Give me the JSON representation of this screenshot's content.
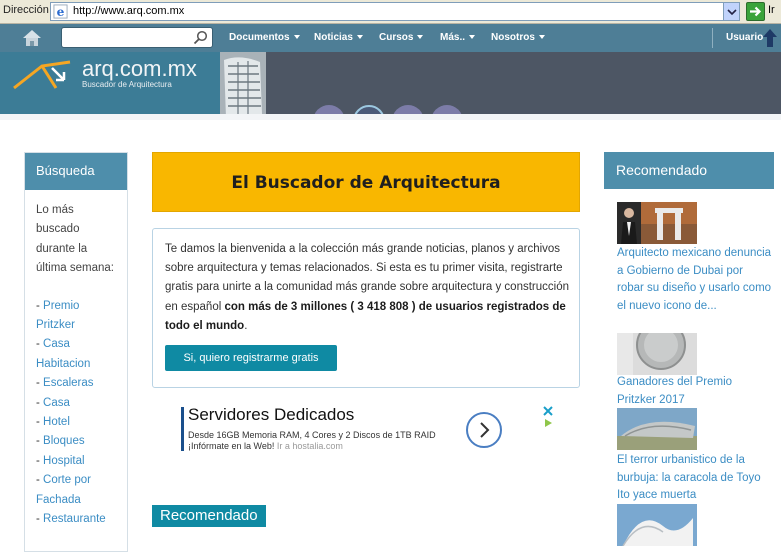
{
  "address_bar": {
    "label": "Dirección",
    "url": "http://www.arq.com.mx",
    "go_label": "Ir"
  },
  "nav": {
    "search_placeholder": "",
    "items": [
      {
        "label": "Documentos"
      },
      {
        "label": "Noticias"
      },
      {
        "label": "Cursos"
      },
      {
        "label": "Más.."
      },
      {
        "label": "Nosotros"
      }
    ],
    "user_label": "Usuario"
  },
  "banner": {
    "logo_title": "arq.com.mx",
    "logo_subtitle": "Buscador de Arquitectura"
  },
  "left_sidebar": {
    "title": "Búsqueda",
    "intro": "Lo más buscado durante la última semana:",
    "links": [
      "Premio Pritzker",
      "Casa Habitacion",
      "Escaleras",
      "Casa",
      "Hotel",
      "Bloques",
      "Hospital",
      "Corte por Fachada",
      "Restaurante"
    ]
  },
  "hero": {
    "title": "El Buscador de Arquitectura"
  },
  "welcome": {
    "text": "Te damos la bienvenida a la colección más grande noticias, planos y archivos sobre arquitectura y temas relacionados. Si esta es tu primer visita, registrarte gratis para unirte a la comunidad más grande sobre arquitectura y construcción en español ",
    "bold": "con más de 3 millones ( 3 418 808 ) de usuarios registrados de todo el mundo",
    "end": ".",
    "button": "Si, quiero registrarme gratis"
  },
  "ad": {
    "title": "Servidores Dedicados",
    "line1": "Desde 16GB Memoria RAM, 4 Cores y 2 Discos de 1TB RAID",
    "line2": "¡Infórmate en la Web!",
    "line2_link": "Ir a hostalia.com"
  },
  "center_recommended": "Recomendado",
  "right_sidebar": {
    "title": "Recomendado",
    "articles": [
      {
        "title": "Arquitecto mexicano denuncia a Gobierno de Dubai por robar su diseño y usarlo como el nuevo icono de..."
      },
      {
        "title": "Ganadores del Premio Pritzker 2017"
      },
      {
        "title": "El terror urbanistico de la burbuja: la caracola de Toyo Ito yace muerta"
      }
    ]
  },
  "colors": {
    "nav_bg": "#4e7e96",
    "panel_head": "#4e8eab",
    "hero_bg": "#f9b700",
    "link": "#3b8dc4",
    "button": "#0f8aa3"
  }
}
